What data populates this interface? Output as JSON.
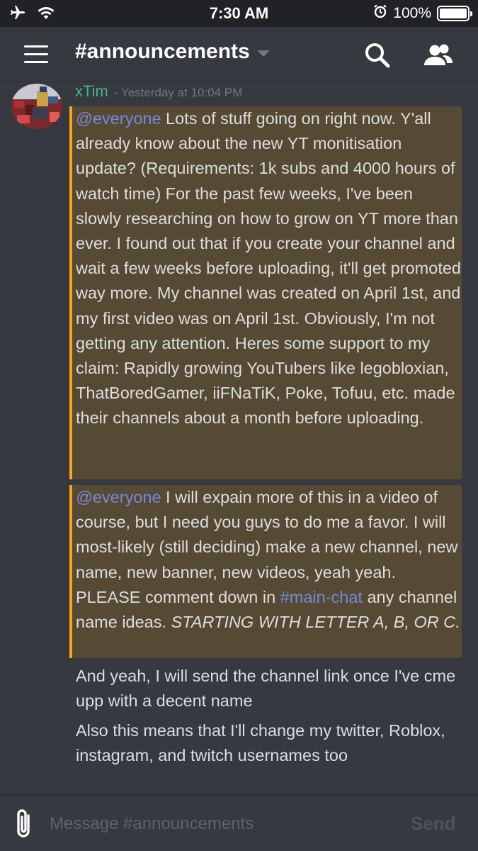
{
  "status_bar": {
    "time": "7:30 AM",
    "battery_text": "100%",
    "battery_level": 1.0,
    "icons": [
      "airplane-icon",
      "wifi-icon",
      "alarm-icon",
      "battery-icon"
    ]
  },
  "header": {
    "channel_name": "#announcements",
    "icons": [
      "hamburger-menu-icon",
      "chevron-down-icon",
      "search-icon",
      "members-icon"
    ]
  },
  "message_group": {
    "author": "xTim",
    "timestamp": "- Yesterday at 10:04 PM",
    "author_color": "#43b581"
  },
  "messages": [
    {
      "highlighted": true,
      "mention": "@everyone",
      "text": " Lots of stuff going on right now. Y'all already know about the new YT monitisation update? (Requirements: 1k subs and 4000 hours of watch time) For the past few weeks, I've been slowly researching on how to grow on YT more than ever. I found out that if you create your channel and wait a few weeks before uploading, it'll get promoted way more. My channel was created on April 1st, and my first video was on April 1st. Obviously, I'm not getting any attention. Heres some support to my claim: Rapidly growing YouTubers like legobloxian, ThatBoredGamer, iiFNaTiK, Poke, Tofuu, etc. made their channels about a month before uploading."
    },
    {
      "highlighted": true,
      "mention": "@everyone",
      "text_a": " I will expain more of this in a video of course, but I need you guys to do me a favor. I will most-likely (still deciding) make a new channel, new name, new banner, new videos, yeah yeah. PLEASE comment down in ",
      "channel_link": "#main-chat",
      "text_b": " any channel name ideas. ",
      "italic": "STARTING WITH LETTER A, B, OR C."
    },
    {
      "highlighted": false,
      "text": "And yeah, I will send the channel link once I've cme upp with a decent name"
    },
    {
      "highlighted": false,
      "text": "Also this means that I'll change my twitter, Roblox, instagram, and twitch usernames too"
    }
  ],
  "composer": {
    "placeholder": "Message #announcements",
    "value": "",
    "send_label": "Send",
    "attach_icon": "paperclip-icon"
  },
  "colors": {
    "background": "#36393f",
    "status_bar": "#202225",
    "mention_highlight_bg": "#564a35",
    "mention_highlight_border": "#faa61a",
    "mention_text": "#7289da",
    "text": "#dcddde",
    "muted": "#72767d"
  }
}
